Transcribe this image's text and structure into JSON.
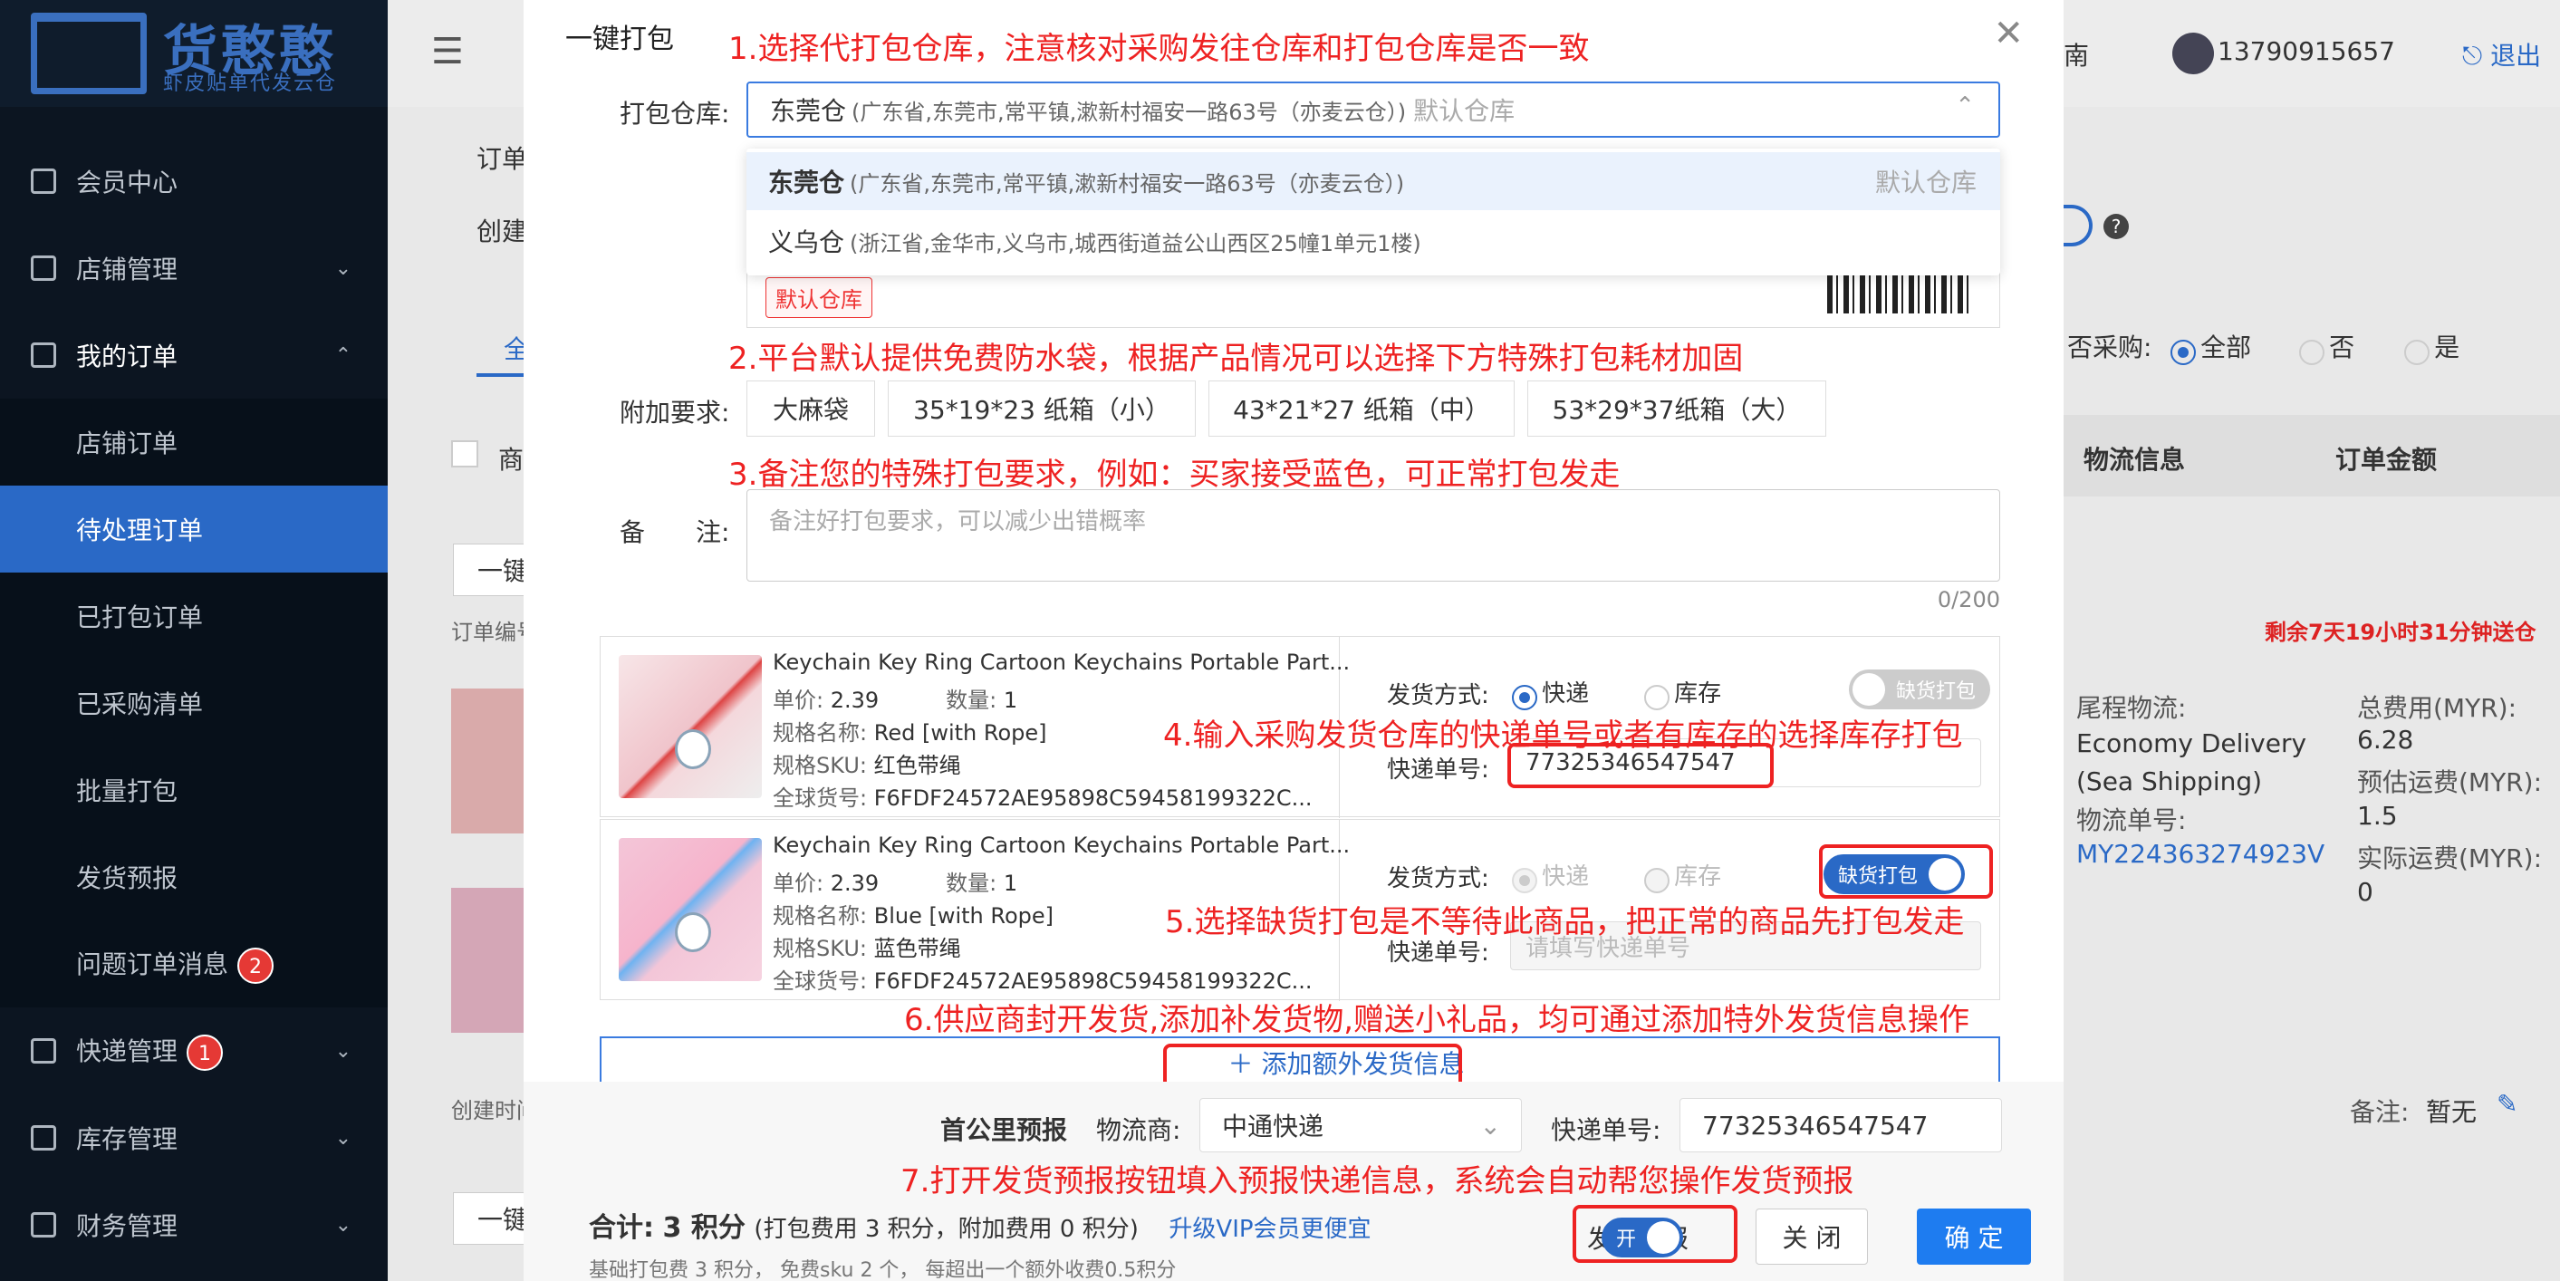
{
  "brand": {
    "title": "货憨憨",
    "subtitle": "虾皮贴单代发云仓"
  },
  "sidebar": {
    "member": "会员中心",
    "store_mgmt": "店铺管理",
    "my_orders": "我的订单",
    "sub": [
      "店铺订单",
      "待处理订单",
      "已打包订单",
      "已采购清单",
      "批量打包",
      "发货预报",
      "问题订单消息"
    ],
    "problem_badge": "2",
    "express_mgmt": "快递管理",
    "express_badge": "1",
    "stock_mgmt": "库存管理",
    "finance_mgmt": "财务管理"
  },
  "topbar": {
    "right_text": "南",
    "phone": "13790915657",
    "logout": "退出"
  },
  "bg": {
    "orders": "订单",
    "created": "创建",
    "all": "全",
    "product": "商",
    "one_key": "一键",
    "order_no": "订单编号",
    "created_time": "创建时间",
    "one_key2": "一键",
    "order_no2": "订单编号",
    "purchase_label": "否采购:",
    "opt_all": "全部",
    "opt_no": "否",
    "opt_yes": "是",
    "col_logistics": "物流信息",
    "col_amount": "订单金额",
    "countdown": "剩余7天19小时31分钟送仓",
    "tail_label": "尾程物流:",
    "tail_value": "Economy Delivery (Sea Shipping)",
    "logi_no_label": "物流单号:",
    "logi_no": "MY224363274923V",
    "total_fee_label": "总费用(MYR):",
    "total_fee": "6.28",
    "est_label": "预估运费(MYR):",
    "est": "1.5",
    "actual_label": "实际运费(MYR):",
    "actual": "0",
    "remark_label": "备注:",
    "remark_value": "暂无"
  },
  "modal": {
    "title": "一键打包",
    "anno1": "1.选择代打包仓库，注意核对采购发往仓库和打包仓库是否一致",
    "anno2": "2.平台默认提供免费防水袋，根据产品情况可以选择下方特殊打包耗材加固",
    "anno3": "3.备注您的特殊打包要求，例如：买家接受蓝色，可正常打包发走",
    "anno4": "4.输入采购发货仓库的快递单号或者有库存的选择库存打包",
    "anno5": "5.选择缺货打包是不等待此商品，把正常的商品先打包发走",
    "anno6": "6.供应商封开发货,添加补发货物,赠送小礼品，均可通过添加特外发货信息操作",
    "anno7": "7.打开发货预报按钮填入预报快递信息，系统会自动帮您操作发货预报",
    "warehouse_label": "打包仓库:",
    "warehouse_selected": "东莞仓",
    "warehouse_selected_addr": "(广东省,东莞市,常平镇,漱新村福安一路63号（亦麦云仓）)",
    "default_wh": "默认仓库",
    "options": [
      {
        "name": "东莞仓",
        "addr": "(广东省,东莞市,常平镇,漱新村福安一路63号（亦麦云仓）)",
        "tag": "默认仓库"
      },
      {
        "name": "义乌仓",
        "addr": "(浙江省,金华市,义乌市,城西街道益公山西区25幢1单元1楼)"
      }
    ],
    "default_tag": "默认仓库",
    "extra_label": "附加要求:",
    "extras": [
      "大麻袋",
      "35*19*23 纸箱（小）",
      "43*21*27 纸箱（中）",
      "53*29*37纸箱（大）"
    ],
    "remark_label": "备　　注:",
    "remark_placeholder": "备注好打包要求，可以减少出错概率",
    "remark_count": "0/200",
    "products": [
      {
        "name": "Keychain Key Ring Cartoon Keychains Portable Part...",
        "price_label": "单价:",
        "price": "2.39",
        "qty_label": "数量:",
        "qty": "1",
        "spec_label": "规格名称:",
        "spec": "Red [with Rope]",
        "sku_label": "规格SKU:",
        "sku": "红色带绳",
        "gid_label": "全球货号:",
        "gid": "F6FDF24572AE95898C59458199322C...",
        "ship_label": "发货方式:",
        "opt_express": "快递",
        "opt_stock": "库存",
        "shortage": "缺货打包",
        "exp_label": "快递单号:",
        "exp_no": "77325346547547"
      },
      {
        "name": "Keychain Key Ring Cartoon Keychains Portable Part...",
        "price_label": "单价:",
        "price": "2.39",
        "qty_label": "数量:",
        "qty": "1",
        "spec_label": "规格名称:",
        "spec": "Blue [with Rope]",
        "sku_label": "规格SKU:",
        "sku": "蓝色带绳",
        "gid_label": "全球货号:",
        "gid": "F6FDF24572AE95898C59458199322C...",
        "ship_label": "发货方式:",
        "opt_express": "快递",
        "opt_stock": "库存",
        "shortage": "缺货打包",
        "exp_label": "快递单号:",
        "exp_placeholder": "请填写快递单号"
      }
    ],
    "add_extra": "添加额外发货信息",
    "first_mile_label": "首公里预报",
    "carrier_label": "物流商:",
    "carrier": "中通快递",
    "fm_exp_label": "快递单号:",
    "fm_exp_no": "77325346547547",
    "total_label": "合计:",
    "total_value": "3 积分",
    "total_detail": "(打包费用 3 积分，附加费用 0 积分)",
    "upgrade": "升级VIP会员更便宜",
    "fee_note": "基础打包费 3 积分，  免费sku 2 个，  每超出一个额外收费0.5积分",
    "forecast_label": "发货预报",
    "forecast_on": "开",
    "close_btn": "关 闭",
    "confirm_btn": "确 定"
  }
}
